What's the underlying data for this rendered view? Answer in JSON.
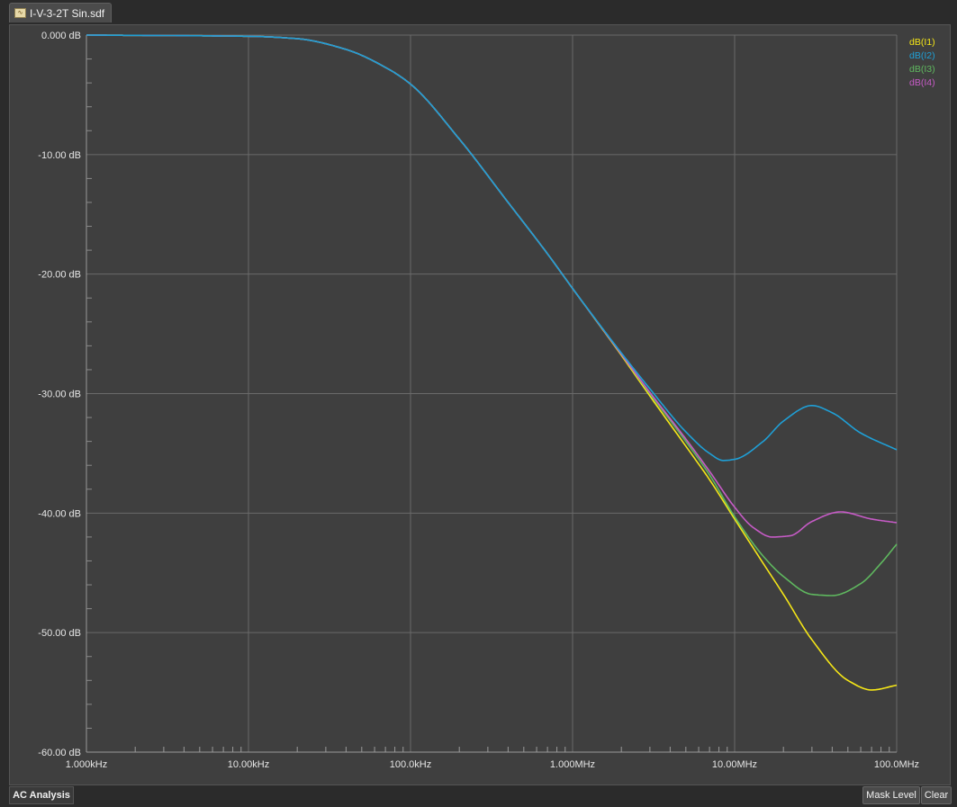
{
  "document_tab": {
    "title": "I-V-3-2T Sin.sdf *",
    "icon": "waveform-document-icon"
  },
  "analysis_tab": {
    "label": "AC Analysis"
  },
  "buttons": {
    "mask_level": "Mask Level",
    "clear": "Clear"
  },
  "chart_data": {
    "type": "line",
    "x_scale": "log",
    "xlim": [
      1000,
      100000000
    ],
    "ylim": [
      -60,
      0
    ],
    "x_ticks": [
      {
        "value": 1000,
        "label": "1.000kHz"
      },
      {
        "value": 10000,
        "label": "10.00kHz"
      },
      {
        "value": 100000,
        "label": "100.0kHz"
      },
      {
        "value": 1000000,
        "label": "1.000MHz"
      },
      {
        "value": 10000000,
        "label": "10.00MHz"
      },
      {
        "value": 100000000,
        "label": "100.0MHz"
      }
    ],
    "y_ticks": [
      {
        "value": 0,
        "label": "0.000 dB"
      },
      {
        "value": -10,
        "label": "-10.00 dB"
      },
      {
        "value": -20,
        "label": "-20.00 dB"
      },
      {
        "value": -30,
        "label": "-30.00 dB"
      },
      {
        "value": -40,
        "label": "-40.00 dB"
      },
      {
        "value": -50,
        "label": "-50.00 dB"
      },
      {
        "value": -60,
        "label": "-60.00 dB"
      }
    ],
    "grid": true,
    "legend_position": "top-right",
    "series": [
      {
        "name": "dB(I1)",
        "color": "#f5e617",
        "x": [
          1000,
          10000,
          20000,
          40000,
          70000,
          100000,
          200000,
          400000,
          700000,
          1000000,
          2000000,
          3000000,
          5000000,
          7000000,
          10000000,
          15000000,
          20000000,
          30000000,
          50000000,
          70000000,
          100000000
        ],
        "y": [
          0,
          -0.1,
          -0.3,
          -1.2,
          -2.7,
          -4.1,
          -8.7,
          -14.0,
          -18.3,
          -21.2,
          -26.8,
          -30.2,
          -34.4,
          -37.2,
          -40.5,
          -44.2,
          -46.8,
          -50.6,
          -54.0,
          -54.8,
          -54.4
        ]
      },
      {
        "name": "dB(I2)",
        "color": "#1f9fd6",
        "x": [
          1000,
          10000,
          20000,
          40000,
          70000,
          100000,
          200000,
          400000,
          700000,
          1000000,
          2000000,
          3000000,
          5000000,
          7000000,
          8500000,
          10000000,
          15000000,
          20000000,
          30000000,
          40000000,
          60000000,
          100000000
        ],
        "y": [
          0,
          -0.1,
          -0.3,
          -1.2,
          -2.7,
          -4.1,
          -8.7,
          -14.0,
          -18.3,
          -21.2,
          -26.6,
          -29.6,
          -33.2,
          -35.0,
          -35.6,
          -35.5,
          -34.0,
          -32.3,
          -31.0,
          -31.6,
          -33.3,
          -34.7
        ]
      },
      {
        "name": "dB(I3)",
        "color": "#5fb85f",
        "x": [
          1000,
          10000,
          20000,
          40000,
          70000,
          100000,
          200000,
          400000,
          700000,
          1000000,
          2000000,
          3000000,
          5000000,
          7000000,
          10000000,
          15000000,
          20000000,
          30000000,
          40000000,
          60000000,
          80000000,
          100000000
        ],
        "y": [
          0,
          -0.1,
          -0.3,
          -1.2,
          -2.7,
          -4.1,
          -8.7,
          -14.0,
          -18.3,
          -21.2,
          -26.7,
          -30.0,
          -34.0,
          -36.8,
          -40.3,
          -43.6,
          -45.3,
          -46.8,
          -46.9,
          -45.9,
          -44.2,
          -42.6
        ]
      },
      {
        "name": "dB(I4)",
        "color": "#c65bc6",
        "x": [
          1000,
          10000,
          20000,
          40000,
          70000,
          100000,
          200000,
          400000,
          700000,
          1000000,
          2000000,
          3000000,
          5000000,
          7000000,
          10000000,
          13000000,
          17000000,
          22000000,
          30000000,
          45000000,
          70000000,
          100000000
        ],
        "y": [
          0,
          -0.1,
          -0.3,
          -1.2,
          -2.7,
          -4.1,
          -8.7,
          -14.0,
          -18.3,
          -21.2,
          -26.7,
          -29.9,
          -33.8,
          -36.5,
          -39.5,
          -41.2,
          -42.0,
          -41.9,
          -40.7,
          -39.9,
          -40.5,
          -40.8
        ]
      }
    ]
  }
}
